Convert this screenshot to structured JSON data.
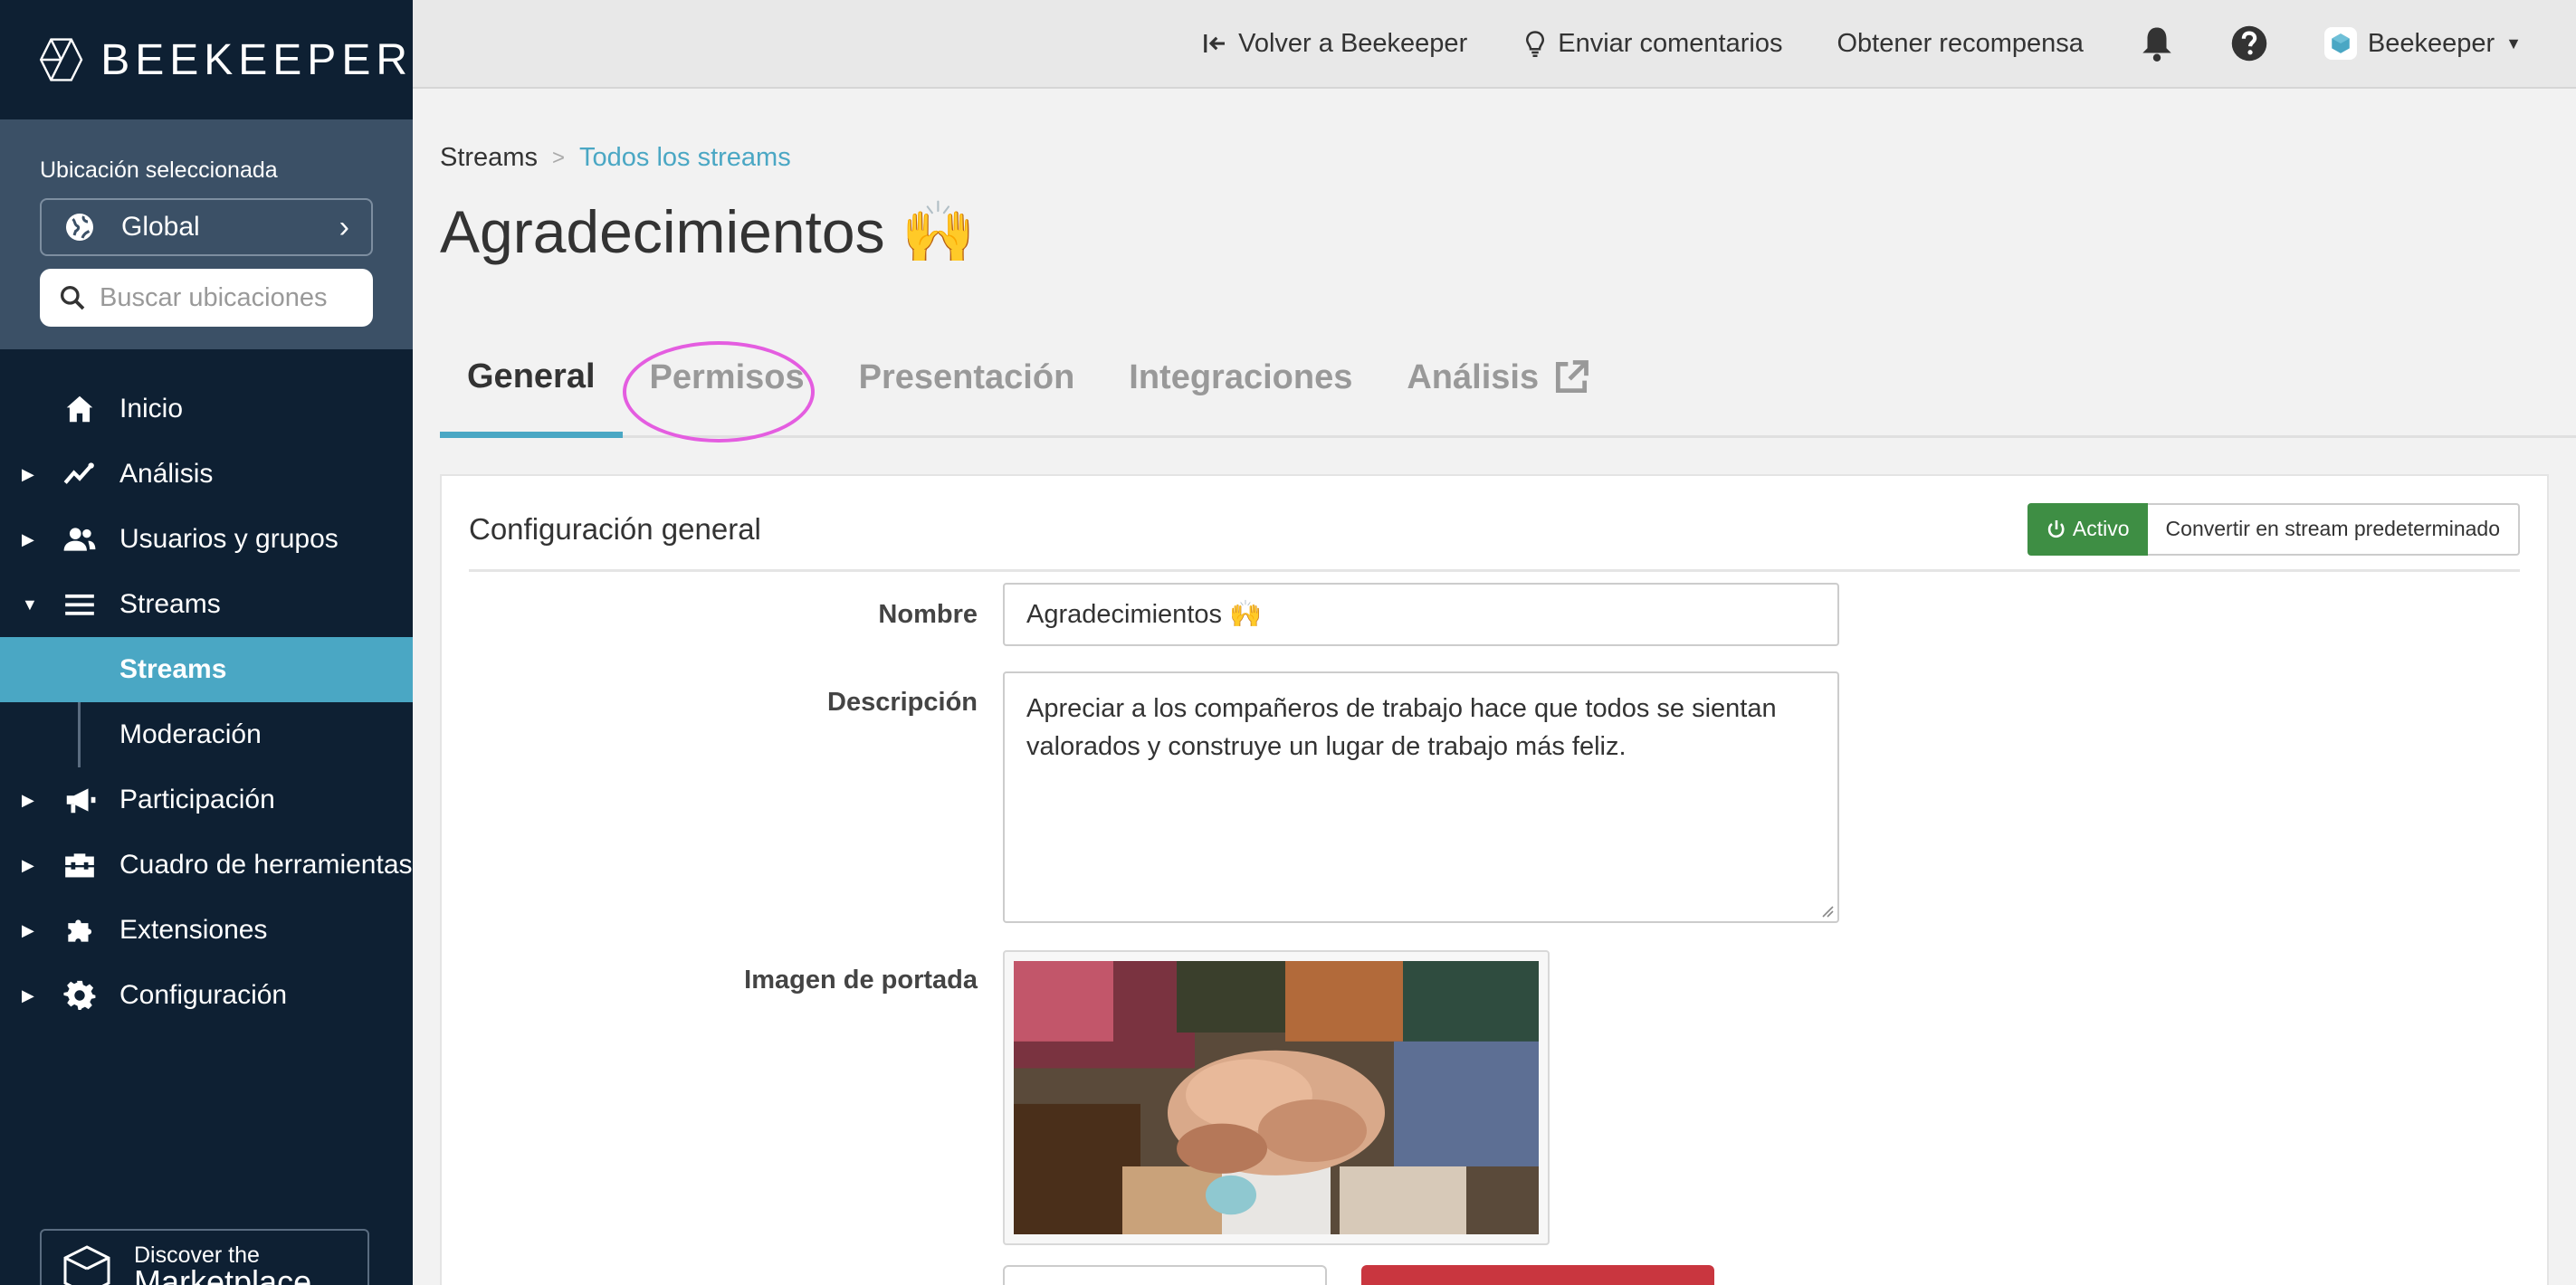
{
  "app": {
    "logo_text": "BEEKEEPER"
  },
  "sidebar": {
    "location_label": "Ubicación seleccionada",
    "location_value": "Global",
    "location_search_placeholder": "Buscar ubicaciones",
    "items": [
      {
        "label": "Inicio",
        "icon": "home-icon"
      },
      {
        "label": "Análisis",
        "icon": "trend-icon"
      },
      {
        "label": "Usuarios y grupos",
        "icon": "users-icon"
      },
      {
        "label": "Streams",
        "icon": "menu-icon"
      },
      {
        "label": "Participación",
        "icon": "megaphone-icon"
      },
      {
        "label": "Cuadro de herramientas",
        "icon": "toolbox-icon"
      },
      {
        "label": "Extensiones",
        "icon": "puzzle-icon"
      },
      {
        "label": "Configuración",
        "icon": "gear-icon"
      }
    ],
    "subitems": [
      {
        "label": "Streams",
        "active": true
      },
      {
        "label": "Moderación",
        "active": false
      }
    ],
    "marketplace": {
      "line1": "Discover the",
      "line2": "Marketplace"
    }
  },
  "topbar": {
    "back_label": "Volver a Beekeeper",
    "feedback_label": "Enviar comentarios",
    "reward_label": "Obtener recompensa",
    "user_label": "Beekeeper"
  },
  "breadcrumb": {
    "root": "Streams",
    "separator": ">",
    "current": "Todos los streams"
  },
  "page": {
    "title": "Agradecimientos 🙌"
  },
  "tabs": [
    "General",
    "Permisos",
    "Presentación",
    "Integraciones",
    "Análisis"
  ],
  "card": {
    "title": "Configuración general",
    "status_button": "Activo",
    "default_button": "Convertir en stream predeterminado",
    "name_label": "Nombre",
    "name_value": "Agradecimientos 🙌",
    "description_label": "Descripción",
    "description_value": "Apreciar a los compañeros de trabajo hace que todos se sientan valorados y construye un lugar de trabajo más feliz.",
    "cover_label": "Imagen de portada"
  },
  "colors": {
    "sidebar_bg": "#0e2033",
    "accent": "#4aa7c4",
    "active_green": "#3e8e44",
    "danger_red": "#c9363f",
    "highlight_circle": "#e45de0"
  }
}
